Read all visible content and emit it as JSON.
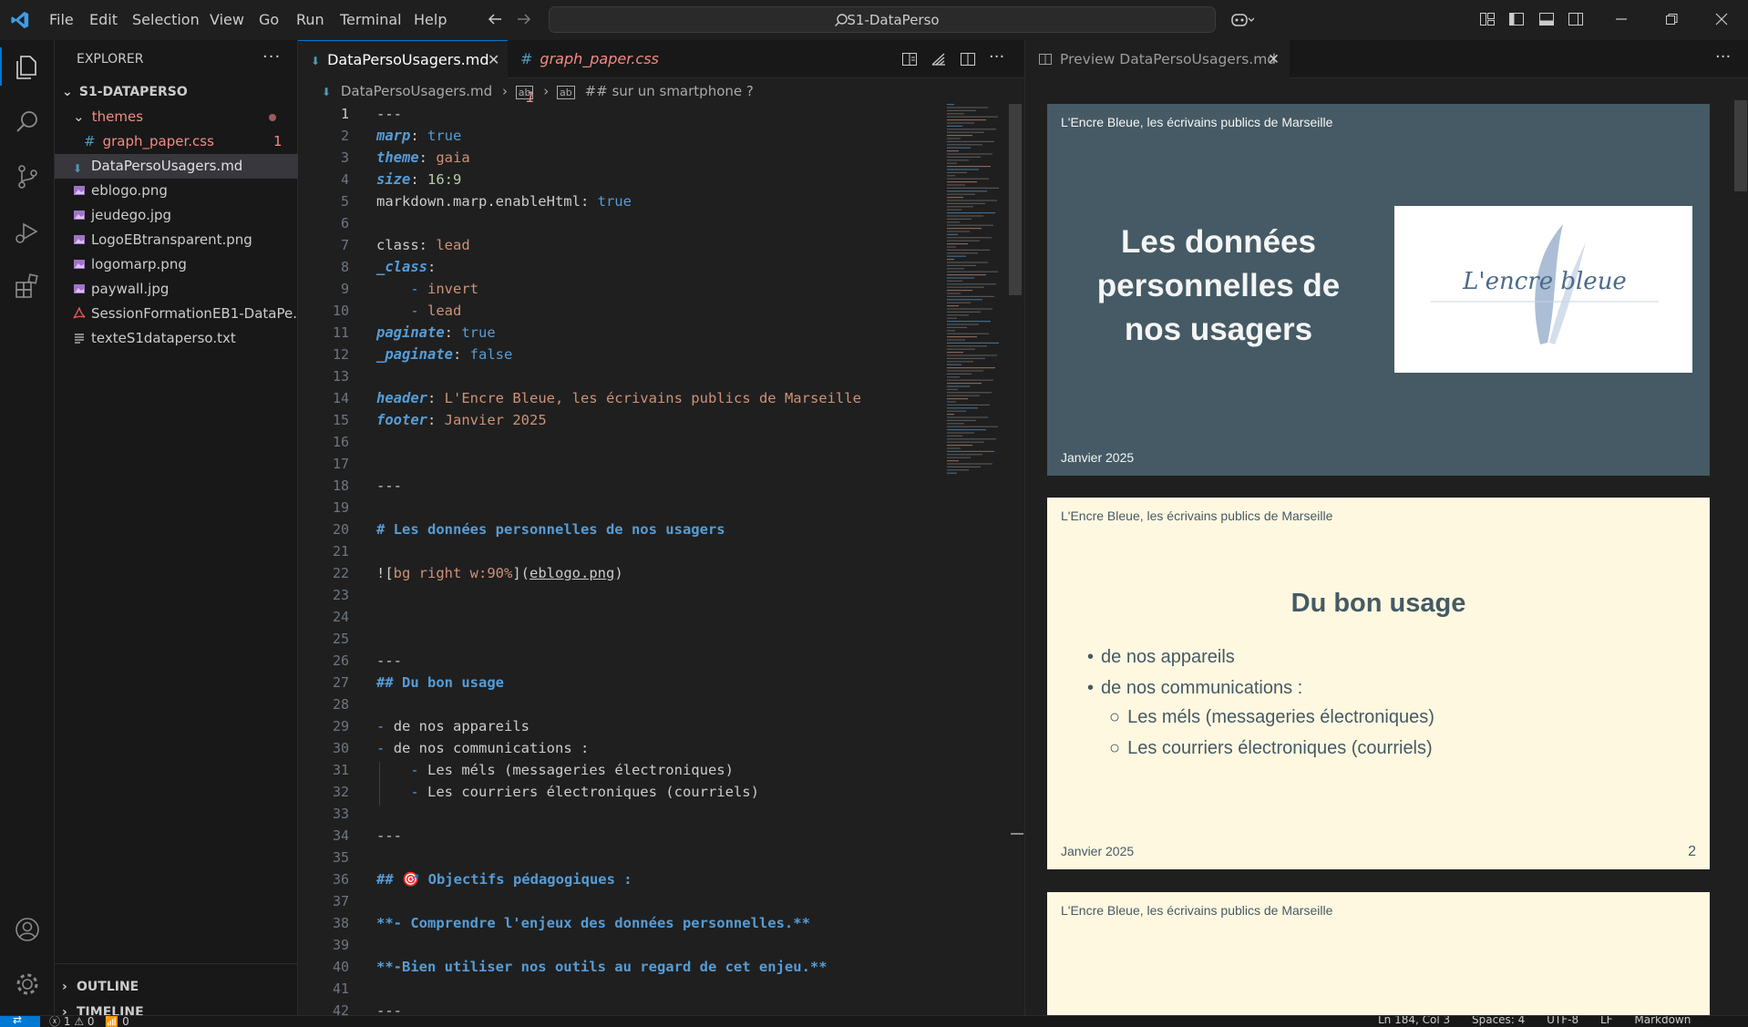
{
  "menu": [
    "File",
    "Edit",
    "Selection",
    "View",
    "Go",
    "Run",
    "Terminal",
    "Help"
  ],
  "search": {
    "text": "S1-DataPerso"
  },
  "sidebar": {
    "title": "EXPLORER",
    "root": "S1-DATAPERSO",
    "folder": "themes",
    "items": [
      {
        "name": "graph_paper.css",
        "badge": "1",
        "icon": "css-hash-icon"
      },
      {
        "name": "DataPersoUsagers.md",
        "icon": "markdown-icon"
      },
      {
        "name": "eblogo.png",
        "icon": "image-icon"
      },
      {
        "name": "jeudego.jpg",
        "icon": "image-icon"
      },
      {
        "name": "LogoEBtransparent.png",
        "icon": "image-icon"
      },
      {
        "name": "logomarp.png",
        "icon": "image-icon"
      },
      {
        "name": "paywall.jpg",
        "icon": "image-icon"
      },
      {
        "name": "SessionFormationEB1-DataPe...",
        "icon": "pdf-icon"
      },
      {
        "name": "texteS1dataperso.txt",
        "icon": "text-file-icon"
      }
    ],
    "outline": "OUTLINE",
    "timeline": "TIMELINE"
  },
  "editor": {
    "tabs": [
      {
        "label": "DataPersoUsagers.md"
      },
      {
        "label": "graph_paper.css",
        "badge": "1"
      }
    ],
    "breadcrumb": {
      "file": "DataPersoUsagers.md",
      "section": "## sur un smartphone ?"
    }
  },
  "code": {
    "l1": "---",
    "l2k": "marp",
    "l2v": "true",
    "l3k": "theme",
    "l3v": "gaia",
    "l4k": "size",
    "l4v": "16:9",
    "l5k": "markdown.marp.enableHtml",
    "l5v": "true",
    "l7k": "class",
    "l7v": "lead",
    "l8k": "_class",
    "l9v": "invert",
    "l10v": "lead",
    "l11k": "paginate",
    "l11v": "true",
    "l12k": "_paginate",
    "l12v": "false",
    "l14k": "header",
    "l14v": "L'Encre Bleue, les écrivains publics de Marseille",
    "l15k": "footer",
    "l15v": "Janvier 2025",
    "l18": "---",
    "l20": "# Les données personnelles de nos usagers",
    "l22alt": "bg right w:90%",
    "l22src": "eblogo.png",
    "l26": "---",
    "l27": "## Du bon usage",
    "l29": "de nos appareils",
    "l30": "de nos communications :",
    "l31": "Les méls (messageries électroniques)",
    "l32": "Les courriers électroniques (courriels)",
    "l34": "---",
    "l36pre": "## ",
    "l36emoji": "🎯",
    "l36post": " Objectifs pédagogiques :",
    "l38": "**- Comprendre l'enjeux des données personnelles.**",
    "l40": "**-Bien utiliser nos outils au regard de cet enjeu.**",
    "l42": "---"
  },
  "preview": {
    "tab": "Preview DataPersoUsagers.md",
    "header": "L'Encre Bleue, les écrivains publics de Marseille",
    "footer": "Janvier 2025",
    "slide1": {
      "title": "Les données personnelles de nos usagers",
      "logo": "L'encre bleue"
    },
    "slide2": {
      "title": "Du bon usage",
      "b1": "de nos appareils",
      "b2": "de nos communications :",
      "b3": "Les méls (messageries électroniques)",
      "b4": "Les courriers électroniques (courriels)",
      "page": "2"
    }
  },
  "status": {
    "errors": "1",
    "warnings": "0",
    "ports": "0",
    "position": "Ln 184, Col 3",
    "spaces": "Spaces: 4",
    "encoding": "UTF-8",
    "eol": "LF",
    "language": "Markdown"
  },
  "colors": {
    "accent": "#0078d4",
    "slide_dark": "#455a64",
    "slide_light": "#fff8e1"
  }
}
